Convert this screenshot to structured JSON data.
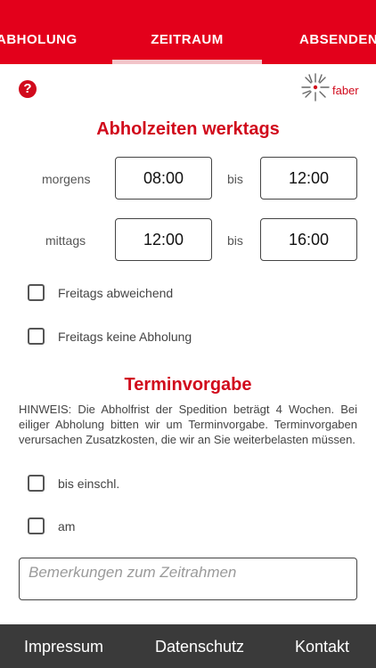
{
  "tabs": [
    {
      "label": "ABHOLUNG"
    },
    {
      "label": "ZEITRAUM"
    },
    {
      "label": "ABSENDEN"
    }
  ],
  "help_icon": {
    "glyph": "?"
  },
  "logo": {
    "text": "faber"
  },
  "pickup": {
    "title": "Abholzeiten werktags",
    "morning": {
      "label": "morgens",
      "from": "08:00",
      "separator": "bis",
      "to": "12:00"
    },
    "afternoon": {
      "label": "mittags",
      "from": "12:00",
      "separator": "bis",
      "to": "16:00"
    },
    "friday_different": {
      "label": "Freitags abweichend",
      "checked": false
    },
    "friday_none": {
      "label": "Freitags keine Abholung",
      "checked": false
    }
  },
  "appointment": {
    "title": "Terminvorgabe",
    "notice": "HINWEIS: Die Abholfrist der Spedition beträgt 4 Wochen. Bei eiliger Abholung bitten wir um Terminvorgabe. Terminvorgaben verursachen Zusatzkosten, die wir an Sie weiterbelasten müssen.",
    "until_option": {
      "label": "bis einschl.",
      "checked": false
    },
    "on_option": {
      "label": "am",
      "checked": false
    }
  },
  "remarks": {
    "placeholder": "Bemerkungen zum Zeitrahmen",
    "value": ""
  },
  "footer": {
    "impressum": "Impressum",
    "datenschutz": "Datenschutz",
    "kontakt": "Kontakt"
  },
  "colors": {
    "brand_red": "#e3001b",
    "footer_bg": "#3a3a3a"
  }
}
